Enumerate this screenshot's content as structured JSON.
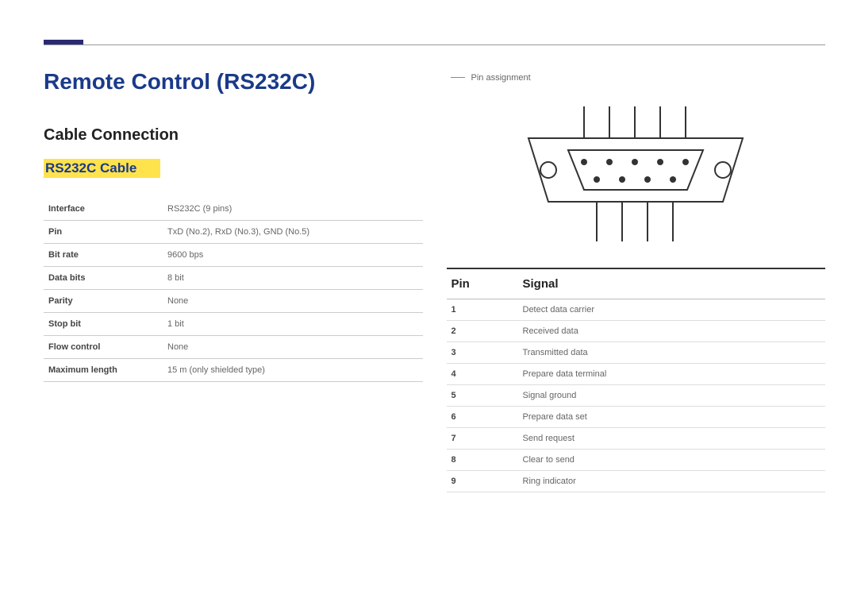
{
  "title": "Remote Control (RS232C)",
  "section_cable_connection": "Cable Connection",
  "rs232_cable": "RS232C Cable",
  "spec": {
    "interface_k": "Interface",
    "interface_v": "RS232C (9 pins)",
    "pin_k": "Pin",
    "pin_v": "TxD (No.2), RxD (No.3), GND (No.5)",
    "bitrate_k": "Bit rate",
    "bitrate_v": "9600 bps",
    "databits_k": "Data bits",
    "databits_v": "8 bit",
    "parity_k": "Parity",
    "parity_v": "None",
    "stopbit_k": "Stop bit",
    "stopbit_v": "1 bit",
    "flow_k": "Flow control",
    "flow_v": "None",
    "maxlen_k": "Maximum length",
    "maxlen_v": "15 m (only shielded type)"
  },
  "hint_label": "Pin assignment",
  "pin_header_pin": "Pin",
  "pin_header_signal": "Signal",
  "pins": [
    {
      "n": "1",
      "s": "Detect data carrier"
    },
    {
      "n": "2",
      "s": "Received data"
    },
    {
      "n": "3",
      "s": "Transmitted data"
    },
    {
      "n": "4",
      "s": "Prepare data terminal"
    },
    {
      "n": "5",
      "s": "Signal ground"
    },
    {
      "n": "6",
      "s": "Prepare data set"
    },
    {
      "n": "7",
      "s": "Send request"
    },
    {
      "n": "8",
      "s": "Clear to send"
    },
    {
      "n": "9",
      "s": "Ring indicator"
    }
  ]
}
